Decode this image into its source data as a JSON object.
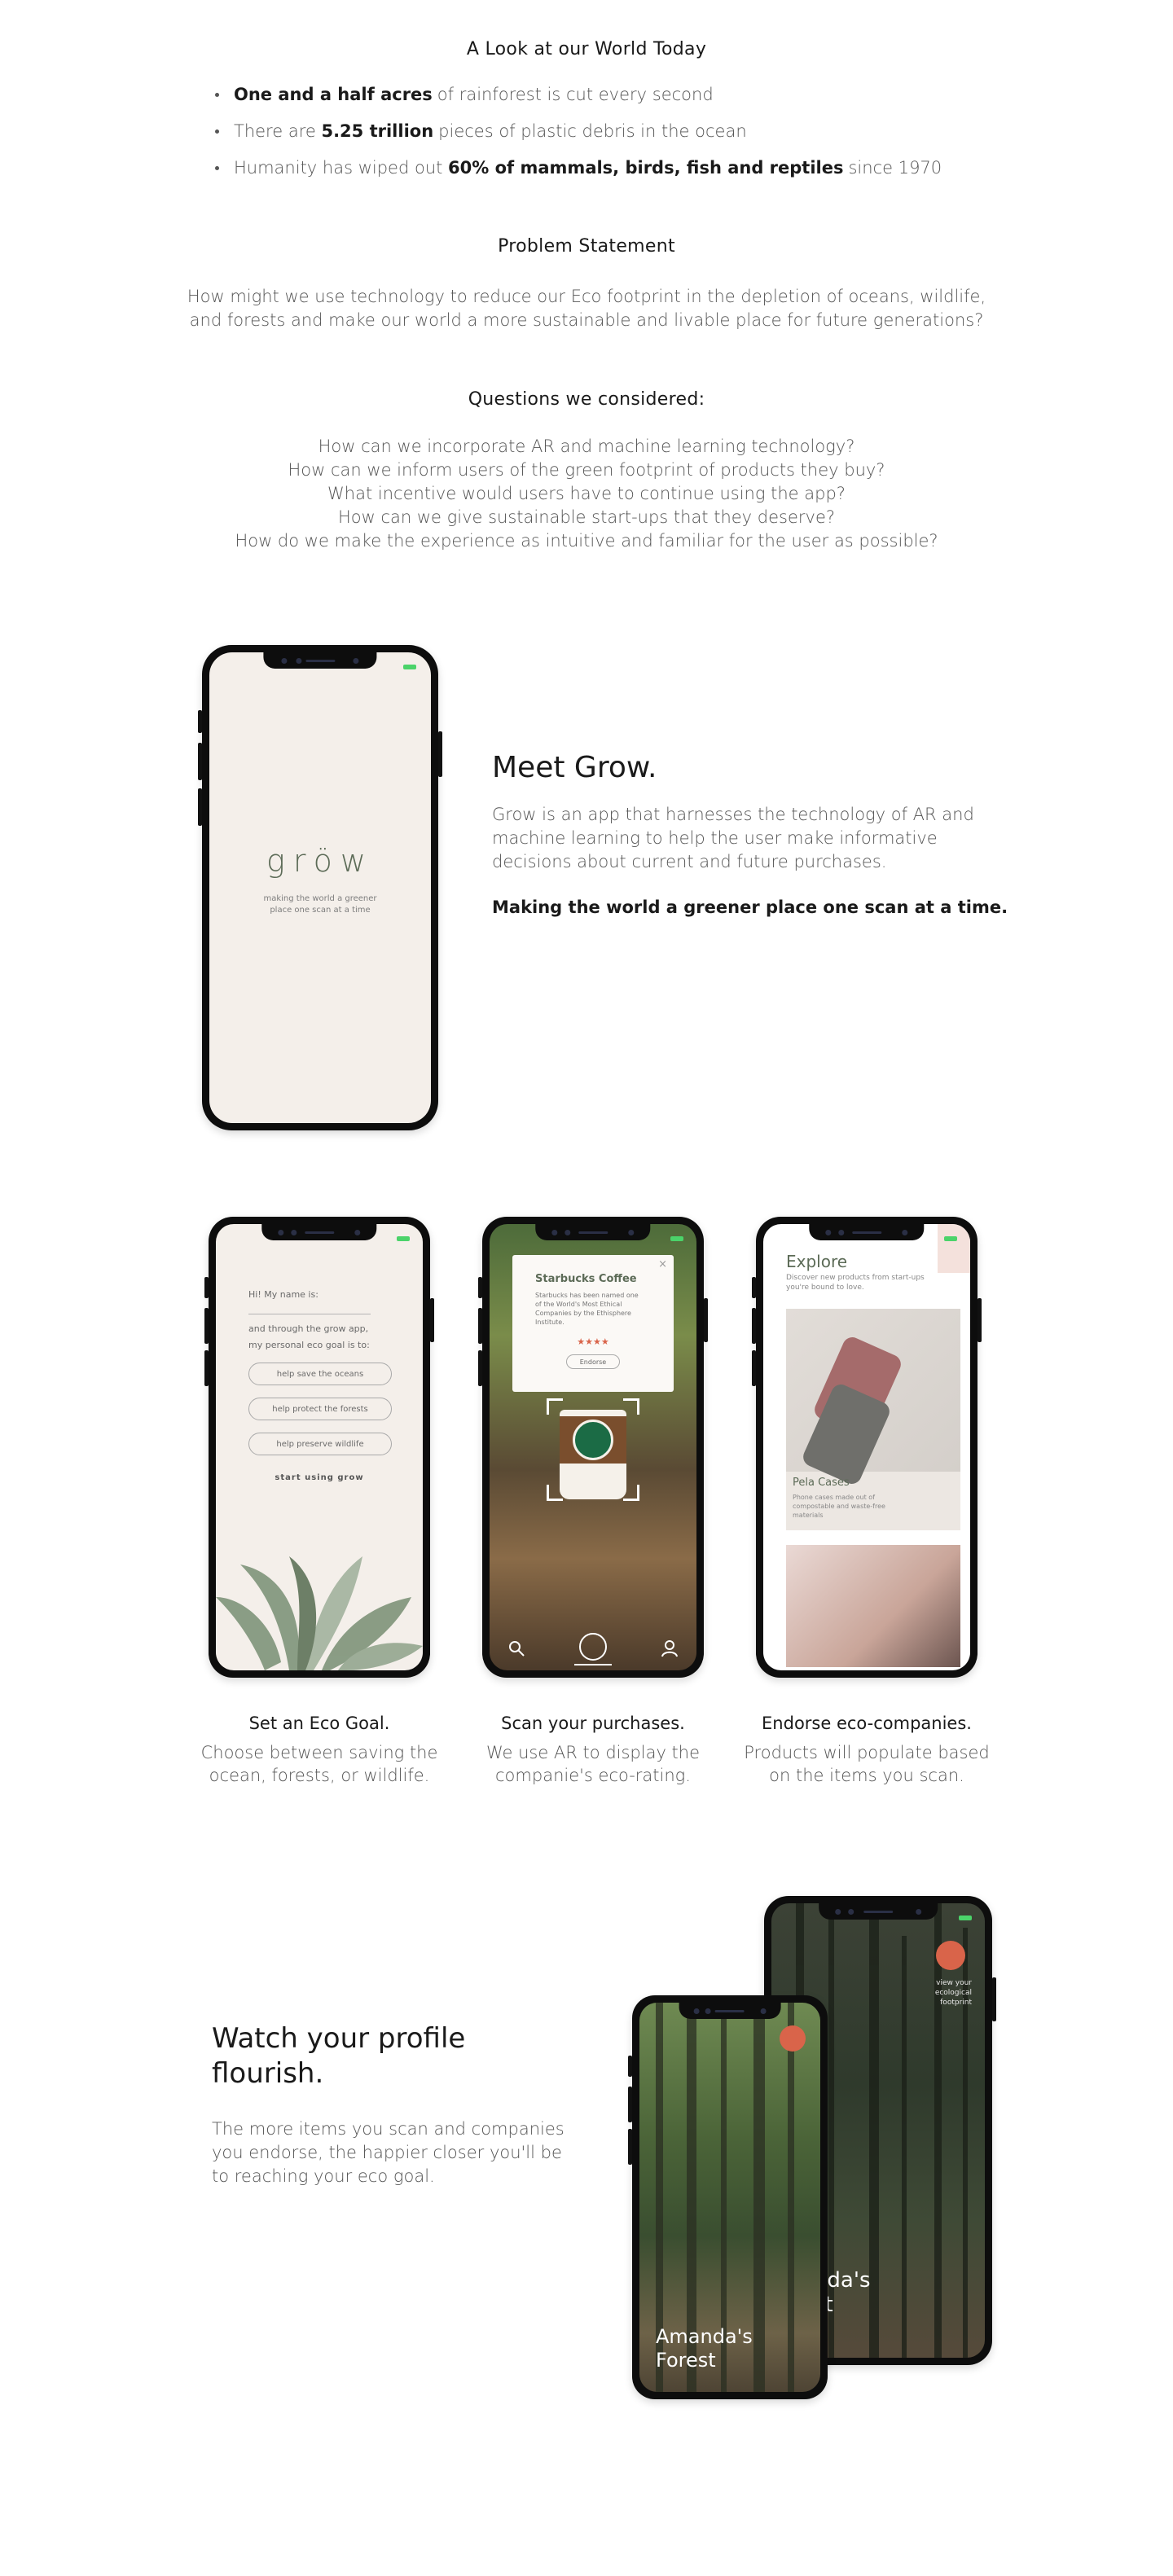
{
  "world": {
    "heading": "A Look at our World Today",
    "facts": [
      {
        "bold": "One and a half acres",
        "pre": "",
        "rest": "of rainforest is cut every second"
      },
      {
        "pre": "There are ",
        "bold": "5.25 trillion",
        "rest": "pieces of plastic debris in the ocean"
      },
      {
        "pre": "Humanity has wiped out ",
        "bold": "60% of mammals, birds, fish and reptiles",
        "rest": "since 1970"
      }
    ]
  },
  "problem": {
    "heading": "Problem Statement",
    "line1": "How might we use technology to reduce our Eco footprint in the depletion of oceans, wildlife,",
    "line2": "and forests and make our world a more sustainable and livable place for future generations?"
  },
  "questions": {
    "heading": "Questions we considered:",
    "items": [
      "How can we incorporate AR and machine learning technology?",
      "How can we inform users of the green footprint of products they buy?",
      "What incentive would users have to continue using the app?",
      "How can we give sustainable start-ups that they deserve?",
      "How do we make the experience as intuitive and familiar for the user as possible?"
    ]
  },
  "meet": {
    "title": "Meet Grow.",
    "body1": "Grow is an app that harnesses the technology of AR and",
    "body2": "machine learning to help the user make informative",
    "body3": "decisions about current and future purchases.",
    "bold": "Making the world a greener place one scan at a time."
  },
  "splash": {
    "logo": "gröw",
    "tag1": "making the world a greener",
    "tag2": "place one scan at a time"
  },
  "goal_screen": {
    "name_label": "Hi! My name is:",
    "line1": "and through the grow app,",
    "line2": "my personal eco goal is to:",
    "opt1": "help save the oceans",
    "opt2": "help protect the forests",
    "opt3": "help preserve wildlife",
    "cta": "start using grow"
  },
  "scan_screen": {
    "card_title": "Starbucks Coffee",
    "card_body": [
      "Starbucks has been named one",
      "of the World's Most Ethical",
      "Companies by the Ethisphere",
      "Institute."
    ],
    "stars": "★★★★",
    "endorse": "Endorse",
    "close": "×"
  },
  "explore_screen": {
    "title": "Explore",
    "sub1": "Discover new products from start-ups",
    "sub2": "you're bound to love.",
    "product": "Pela Cases",
    "desc": [
      "Phone cases made out of",
      "compostable and waste-free",
      "materials"
    ]
  },
  "features": [
    {
      "title": "Set an Eco Goal.",
      "l1": "Choose between saving the",
      "l2": "ocean, forests, or wildlife."
    },
    {
      "title": "Scan your purchases.",
      "l1": "We use AR to display the",
      "l2": "companie's eco-rating."
    },
    {
      "title": "Endorse eco-companies.",
      "l1": "Products will populate based",
      "l2": "on the items you scan."
    }
  ],
  "watch": {
    "title1": "Watch your profile",
    "title2": "flourish.",
    "b1": "The more items you scan and companies",
    "b2": "you endorse, the happier closer you'll be",
    "b3": "to reaching your eco goal."
  },
  "forest": {
    "front1": "Amanda's",
    "front2": "Forest",
    "back1": "anda's",
    "back2": "est",
    "view": [
      "view your",
      "ecological",
      "footprint"
    ]
  },
  "colors": {
    "accent_orange": "#d9644a",
    "battery_green": "#4bd36a",
    "sage": "#5c6b57",
    "cream": "#f4efea"
  }
}
